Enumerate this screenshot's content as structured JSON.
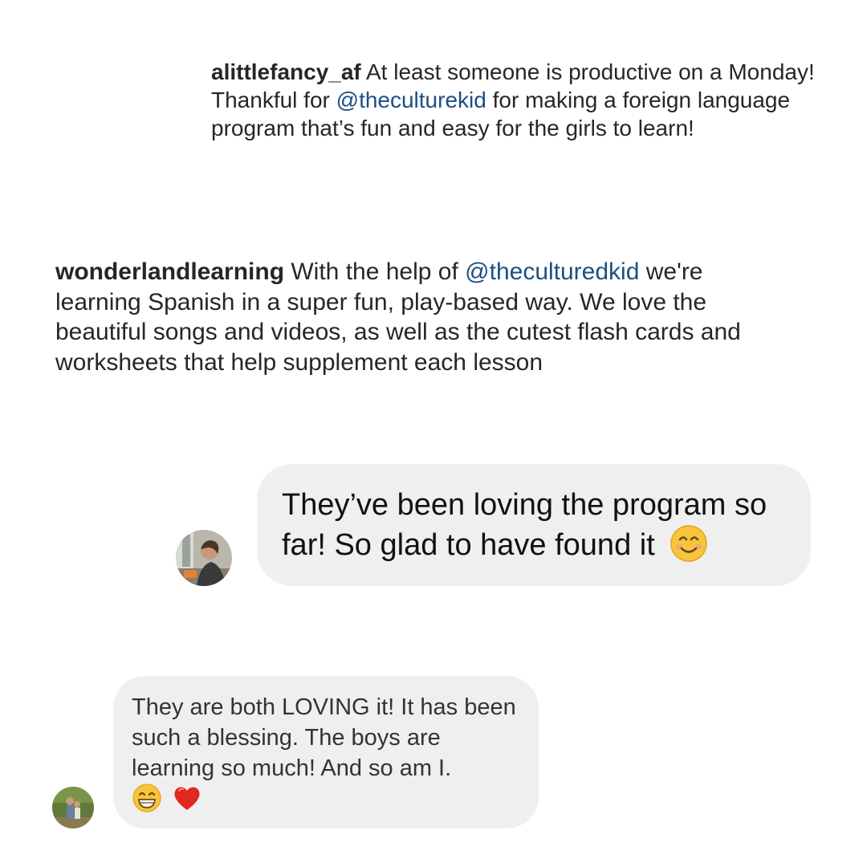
{
  "comments": [
    {
      "username": "alittlefancy_af",
      "text_before": " At least someone is productive on a Monday! Thankful for ",
      "mention": "@theculturekid",
      "text_after": " for making a foreign language program that’s fun and easy for the girls to learn!"
    },
    {
      "username": "wonderlandlearning",
      "text_before": " With the help of ",
      "mention": "@theculturedkid",
      "text_after": " we're learning Spanish in a super fun, play-based way. We love the beautiful songs and videos, as well as the cutest flash cards and worksheets that help supplement each lesson"
    }
  ],
  "messages": [
    {
      "text": "They’ve been loving the program so far! So glad to have found it",
      "emojis": [
        "smiling-face-emoji"
      ]
    },
    {
      "text": "They are both LOVING it! It has been such a blessing. The boys are learning so much! And so am I.",
      "emojis": [
        "grinning-face-emoji",
        "red-heart-emoji"
      ]
    }
  ],
  "colors": {
    "mention": "#1c4f84",
    "bubble": "#efefef",
    "text": "#262626"
  }
}
